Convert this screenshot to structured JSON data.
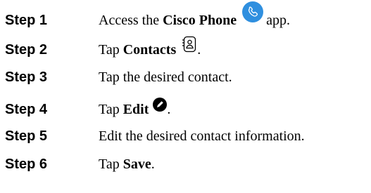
{
  "steps": [
    {
      "label": "Step 1",
      "pre": "Access the ",
      "bold": "Cisco Phone",
      "post": " app.",
      "icon": "phone-icon"
    },
    {
      "label": "Step 2",
      "pre": "Tap ",
      "bold": "Contacts",
      "post": ".",
      "icon": "contacts-icon"
    },
    {
      "label": "Step 3",
      "pre": "Tap the desired contact.",
      "bold": "",
      "post": "",
      "icon": ""
    },
    {
      "label": "Step 4",
      "pre": "Tap ",
      "bold": "Edit",
      "post": ".",
      "icon": "edit-pencil-icon"
    },
    {
      "label": "Step 5",
      "pre": "Edit the desired contact information.",
      "bold": "",
      "post": "",
      "icon": ""
    },
    {
      "label": "Step 6",
      "pre": "Tap ",
      "bold": "Save",
      "post": ".",
      "icon": ""
    }
  ],
  "colors": {
    "phone_icon_bg": "#2f8fdf",
    "text": "#000000"
  }
}
